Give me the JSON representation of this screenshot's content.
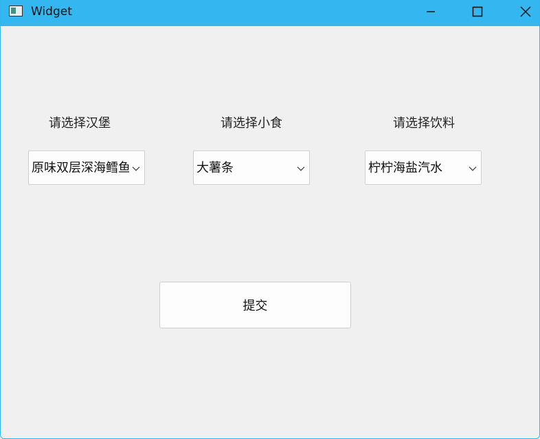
{
  "window": {
    "title": "Widget",
    "app_icon": "window-app-icon",
    "controls": {
      "minimize": "minimize-icon",
      "maximize": "maximize-icon",
      "close": "close-icon"
    },
    "accent_color": "#34b6f0"
  },
  "form": {
    "burger": {
      "label": "请选择汉堡",
      "selected": "原味双层深海鳕鱼"
    },
    "snack": {
      "label": "请选择小食",
      "selected": "大薯条"
    },
    "drink": {
      "label": "请选择饮料",
      "selected": "柠柠海盐汽水"
    },
    "submit_label": "提交"
  }
}
